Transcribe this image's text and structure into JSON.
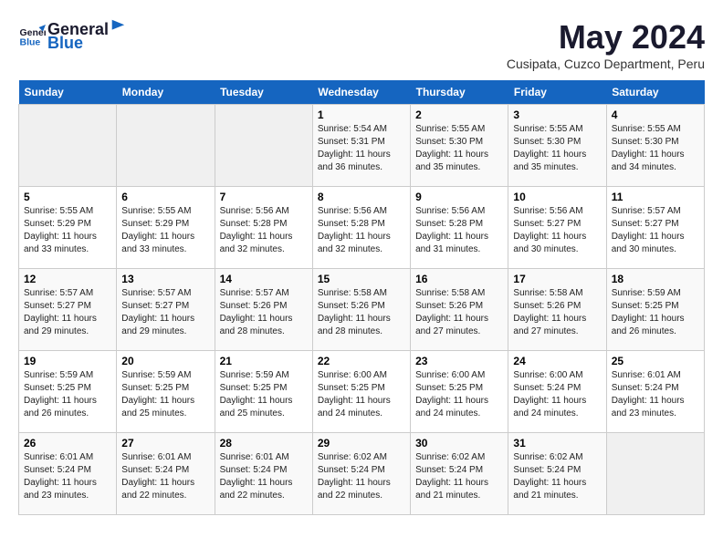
{
  "header": {
    "logo_general": "General",
    "logo_blue": "Blue",
    "month": "May 2024",
    "location": "Cusipata, Cuzco Department, Peru"
  },
  "days_of_week": [
    "Sunday",
    "Monday",
    "Tuesday",
    "Wednesday",
    "Thursday",
    "Friday",
    "Saturday"
  ],
  "weeks": [
    [
      {
        "day": "",
        "info": ""
      },
      {
        "day": "",
        "info": ""
      },
      {
        "day": "",
        "info": ""
      },
      {
        "day": "1",
        "info": "Sunrise: 5:54 AM\nSunset: 5:31 PM\nDaylight: 11 hours and 36 minutes."
      },
      {
        "day": "2",
        "info": "Sunrise: 5:55 AM\nSunset: 5:30 PM\nDaylight: 11 hours and 35 minutes."
      },
      {
        "day": "3",
        "info": "Sunrise: 5:55 AM\nSunset: 5:30 PM\nDaylight: 11 hours and 35 minutes."
      },
      {
        "day": "4",
        "info": "Sunrise: 5:55 AM\nSunset: 5:30 PM\nDaylight: 11 hours and 34 minutes."
      }
    ],
    [
      {
        "day": "5",
        "info": "Sunrise: 5:55 AM\nSunset: 5:29 PM\nDaylight: 11 hours and 33 minutes."
      },
      {
        "day": "6",
        "info": "Sunrise: 5:55 AM\nSunset: 5:29 PM\nDaylight: 11 hours and 33 minutes."
      },
      {
        "day": "7",
        "info": "Sunrise: 5:56 AM\nSunset: 5:28 PM\nDaylight: 11 hours and 32 minutes."
      },
      {
        "day": "8",
        "info": "Sunrise: 5:56 AM\nSunset: 5:28 PM\nDaylight: 11 hours and 32 minutes."
      },
      {
        "day": "9",
        "info": "Sunrise: 5:56 AM\nSunset: 5:28 PM\nDaylight: 11 hours and 31 minutes."
      },
      {
        "day": "10",
        "info": "Sunrise: 5:56 AM\nSunset: 5:27 PM\nDaylight: 11 hours and 30 minutes."
      },
      {
        "day": "11",
        "info": "Sunrise: 5:57 AM\nSunset: 5:27 PM\nDaylight: 11 hours and 30 minutes."
      }
    ],
    [
      {
        "day": "12",
        "info": "Sunrise: 5:57 AM\nSunset: 5:27 PM\nDaylight: 11 hours and 29 minutes."
      },
      {
        "day": "13",
        "info": "Sunrise: 5:57 AM\nSunset: 5:27 PM\nDaylight: 11 hours and 29 minutes."
      },
      {
        "day": "14",
        "info": "Sunrise: 5:57 AM\nSunset: 5:26 PM\nDaylight: 11 hours and 28 minutes."
      },
      {
        "day": "15",
        "info": "Sunrise: 5:58 AM\nSunset: 5:26 PM\nDaylight: 11 hours and 28 minutes."
      },
      {
        "day": "16",
        "info": "Sunrise: 5:58 AM\nSunset: 5:26 PM\nDaylight: 11 hours and 27 minutes."
      },
      {
        "day": "17",
        "info": "Sunrise: 5:58 AM\nSunset: 5:26 PM\nDaylight: 11 hours and 27 minutes."
      },
      {
        "day": "18",
        "info": "Sunrise: 5:59 AM\nSunset: 5:25 PM\nDaylight: 11 hours and 26 minutes."
      }
    ],
    [
      {
        "day": "19",
        "info": "Sunrise: 5:59 AM\nSunset: 5:25 PM\nDaylight: 11 hours and 26 minutes."
      },
      {
        "day": "20",
        "info": "Sunrise: 5:59 AM\nSunset: 5:25 PM\nDaylight: 11 hours and 25 minutes."
      },
      {
        "day": "21",
        "info": "Sunrise: 5:59 AM\nSunset: 5:25 PM\nDaylight: 11 hours and 25 minutes."
      },
      {
        "day": "22",
        "info": "Sunrise: 6:00 AM\nSunset: 5:25 PM\nDaylight: 11 hours and 24 minutes."
      },
      {
        "day": "23",
        "info": "Sunrise: 6:00 AM\nSunset: 5:25 PM\nDaylight: 11 hours and 24 minutes."
      },
      {
        "day": "24",
        "info": "Sunrise: 6:00 AM\nSunset: 5:24 PM\nDaylight: 11 hours and 24 minutes."
      },
      {
        "day": "25",
        "info": "Sunrise: 6:01 AM\nSunset: 5:24 PM\nDaylight: 11 hours and 23 minutes."
      }
    ],
    [
      {
        "day": "26",
        "info": "Sunrise: 6:01 AM\nSunset: 5:24 PM\nDaylight: 11 hours and 23 minutes."
      },
      {
        "day": "27",
        "info": "Sunrise: 6:01 AM\nSunset: 5:24 PM\nDaylight: 11 hours and 22 minutes."
      },
      {
        "day": "28",
        "info": "Sunrise: 6:01 AM\nSunset: 5:24 PM\nDaylight: 11 hours and 22 minutes."
      },
      {
        "day": "29",
        "info": "Sunrise: 6:02 AM\nSunset: 5:24 PM\nDaylight: 11 hours and 22 minutes."
      },
      {
        "day": "30",
        "info": "Sunrise: 6:02 AM\nSunset: 5:24 PM\nDaylight: 11 hours and 21 minutes."
      },
      {
        "day": "31",
        "info": "Sunrise: 6:02 AM\nSunset: 5:24 PM\nDaylight: 11 hours and 21 minutes."
      },
      {
        "day": "",
        "info": ""
      }
    ]
  ]
}
